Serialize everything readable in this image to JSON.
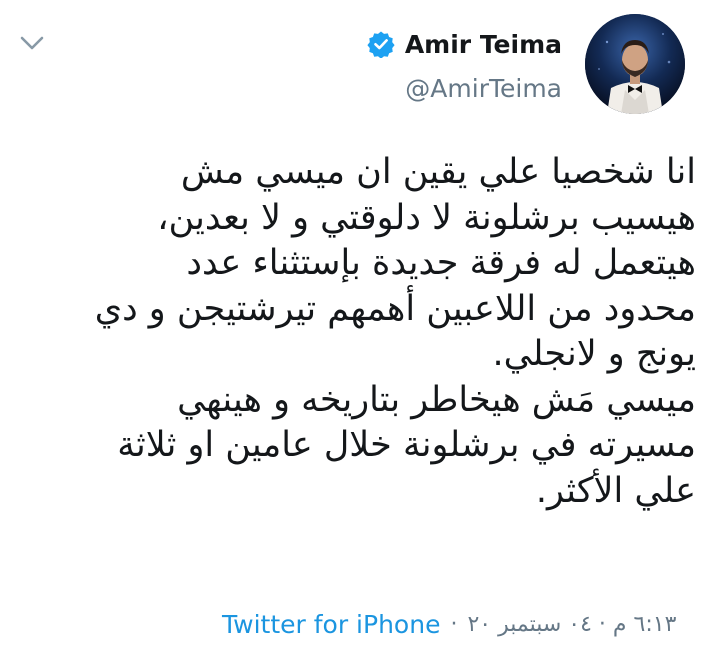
{
  "user": {
    "display_name": "Amir Teima",
    "handle": "@AmirTeima",
    "verified": true
  },
  "tweet": {
    "lines": [
      "انا شخصيا علي يقين ان ميسي مش",
      "هيسيب برشلونة لا دلوقتي و لا بعدين،",
      "هيتعمل له فرقة جديدة بإستثناء عدد",
      "محدود من اللاعبين أهمهم تيرشتيجن و دي",
      "يونج و لانجلي.",
      "ميسي مَش هيخاطر بتاريخه و هينهي",
      "مسيرته في برشلونة خلال عامين او ثلاثة",
      "علي الأكثر."
    ]
  },
  "meta": {
    "source": "Twitter for iPhone",
    "separator": "·",
    "timestamp": "٦:١٣ م · ٠٤ سبتمبر ٢٠"
  },
  "icons": {
    "chevron": "chevron-down-icon",
    "verified": "verified-badge-icon"
  },
  "colors": {
    "text": "#14171a",
    "secondary": "#657786",
    "link": "#1b95e0",
    "verified": "#1da1f2"
  }
}
